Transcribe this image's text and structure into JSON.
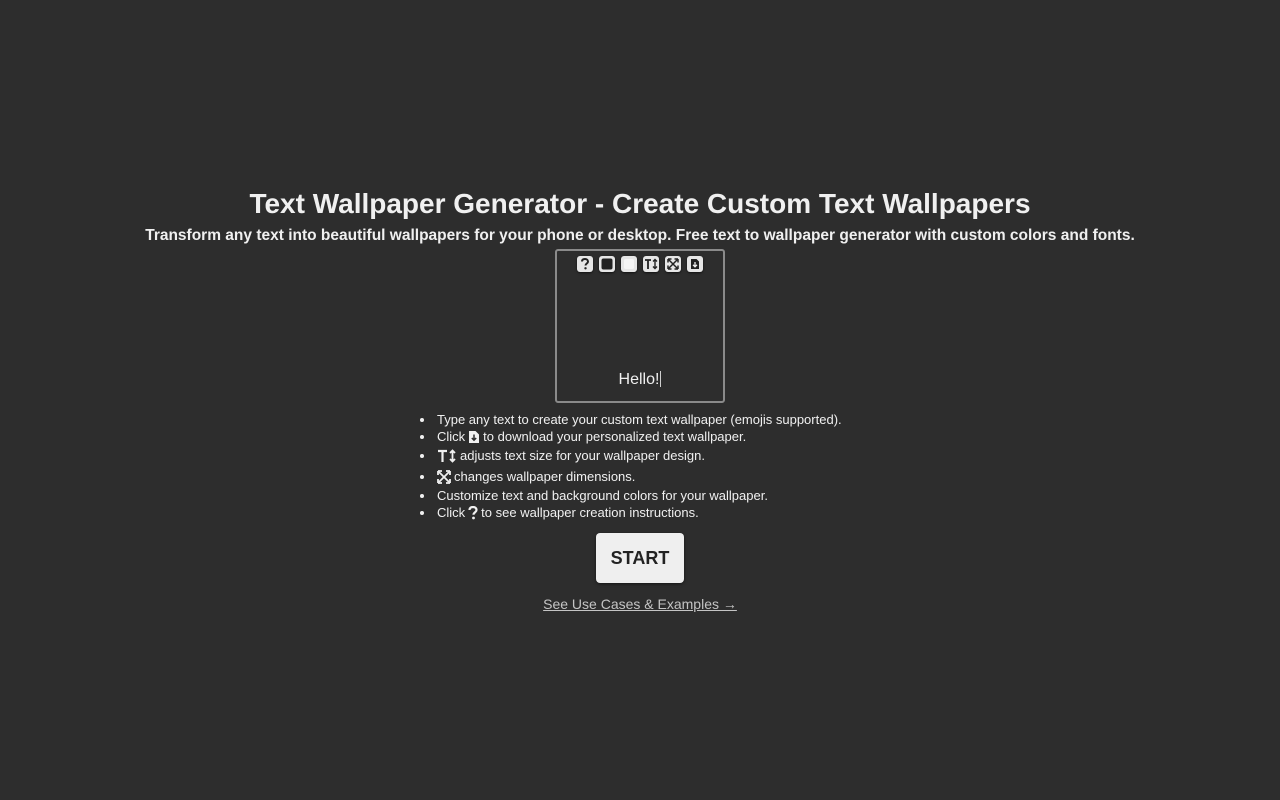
{
  "header": {
    "title": "Text Wallpaper Generator - Create Custom Text Wallpapers",
    "subtitle": "Transform any text into beautiful wallpapers for your phone or desktop. Free text to wallpaper generator with custom colors and fonts."
  },
  "preview": {
    "toolbar": [
      {
        "name": "help-icon",
        "glyph": "?"
      },
      {
        "name": "text-color-icon",
        "glyph": ""
      },
      {
        "name": "background-color-icon",
        "glyph": ""
      },
      {
        "name": "text-size-icon",
        "glyph": "T↕"
      },
      {
        "name": "resize-icon",
        "glyph": ""
      },
      {
        "name": "download-icon",
        "glyph": ""
      }
    ],
    "text": "Hello!"
  },
  "instructions": {
    "item1": "Type any text to create your custom text wallpaper (emojis supported).",
    "item2_prefix": "Click",
    "item2_suffix": "to download your personalized text wallpaper.",
    "item3_suffix": "adjusts text size for your wallpaper design.",
    "item4_suffix": "changes wallpaper dimensions.",
    "item5": "Customize text and background colors for your wallpaper.",
    "item6_prefix": "Click",
    "item6_suffix": "to see wallpaper creation instructions."
  },
  "start_button": {
    "label": "START"
  },
  "examples_link": {
    "label": "See Use Cases & Examples →"
  },
  "colors": {
    "background": "#2d2d2d",
    "text": "#f0f0f0",
    "button": "#efefef",
    "link": "#c4c4c4"
  }
}
